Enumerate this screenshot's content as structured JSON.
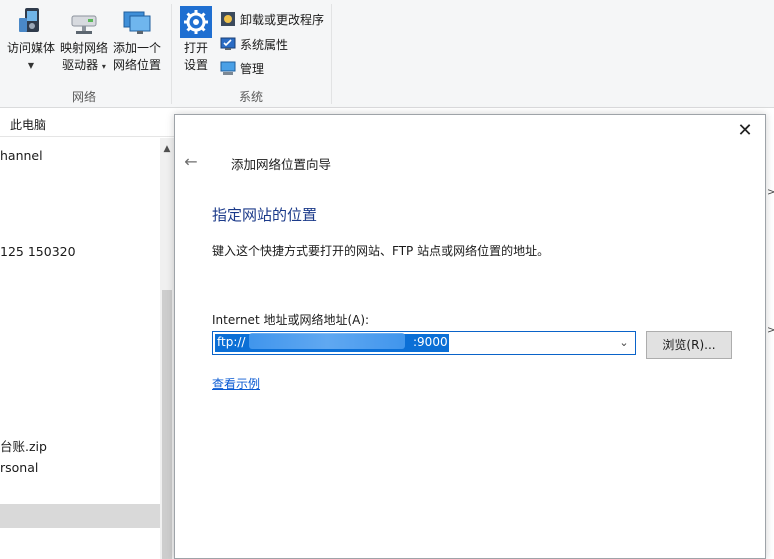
{
  "ribbon": {
    "network_group": {
      "label": "网络",
      "access_media": "访问媒体",
      "map_drive_line1": "映射网络",
      "map_drive_line2": "驱动器",
      "add_location_line1": "添加一个",
      "add_location_line2": "网络位置"
    },
    "system_group": {
      "label": "系统",
      "open_settings_line1": "打开",
      "open_settings_line2": "设置",
      "uninstall": "卸载或更改程序",
      "system_properties": "系统属性",
      "manage": "管理"
    }
  },
  "address_bar": {
    "path": "此电脑"
  },
  "left_pane": {
    "items": [
      "hannel",
      "125 150320",
      "台账.zip",
      "rsonal"
    ]
  },
  "dialog": {
    "title": "添加网络位置向导",
    "heading": "指定网站的位置",
    "description": "键入这个快捷方式要打开的网站、FTP 站点或网络位置的地址。",
    "address_label": "Internet 地址或网络地址(A):",
    "address_value_prefix": "ftp://",
    "address_value_suffix": ":9000",
    "browse_button": "浏览(R)...",
    "example_link": "查看示例"
  },
  "icons": {
    "close": "close-icon",
    "back": "back-arrow-icon",
    "dropdown": "chevron-down-icon"
  },
  "colors": {
    "heading": "#1b3a8a",
    "link": "#0b5bd3",
    "selection": "#0b6fd6",
    "focus_border": "#0a63c9"
  }
}
